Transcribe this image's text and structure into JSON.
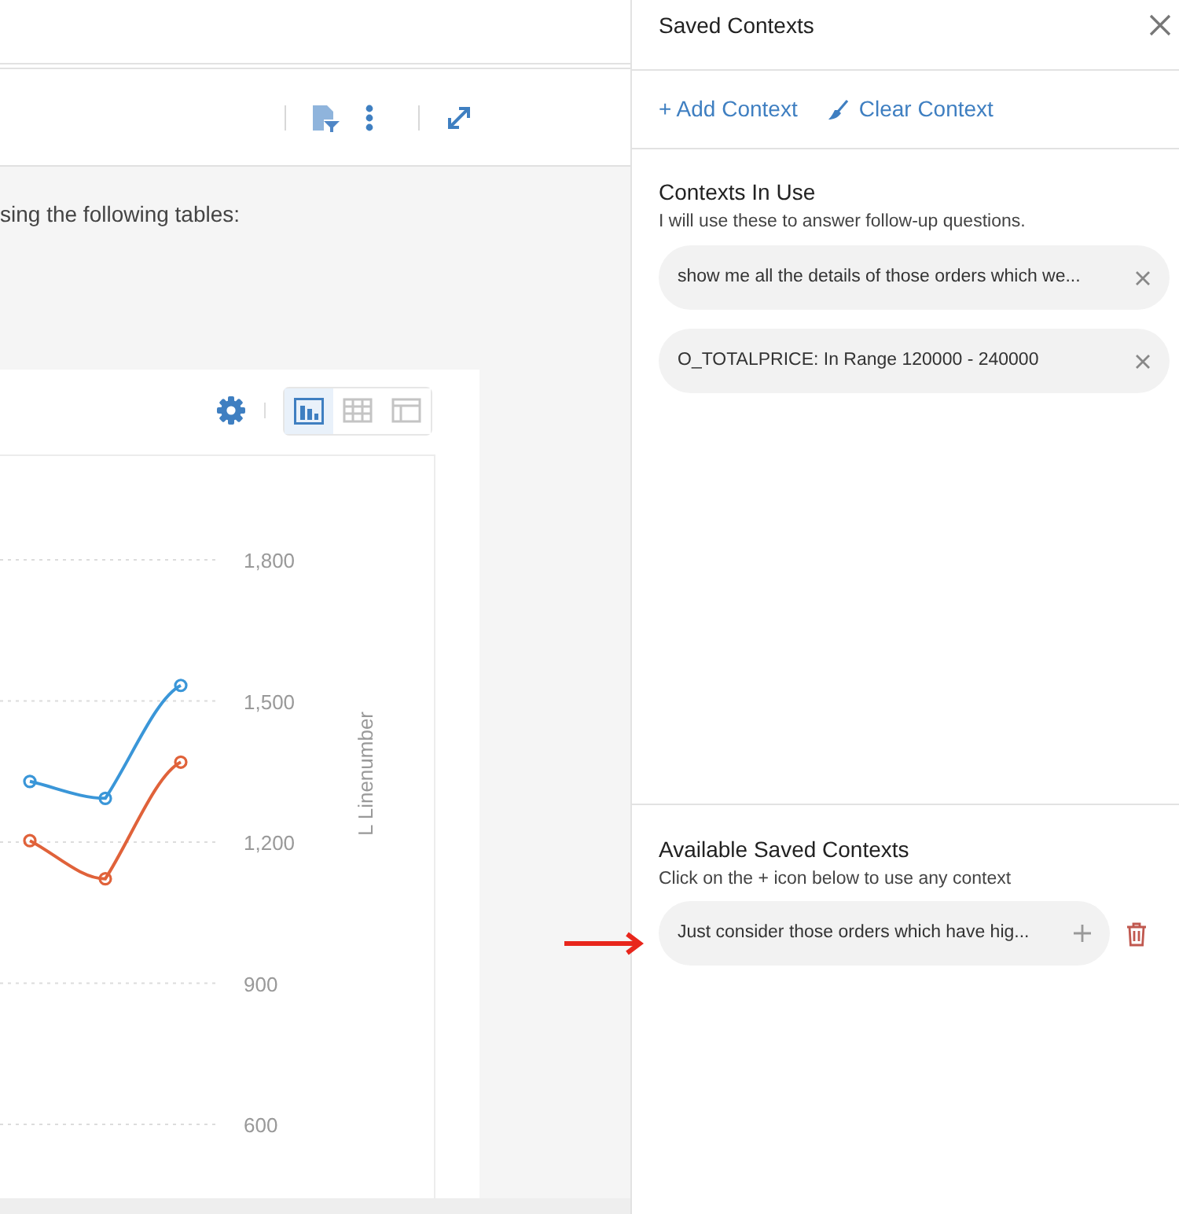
{
  "message": {
    "text": "sing the following tables:"
  },
  "chart_toolbar": {
    "views": [
      {
        "kind": "chart",
        "selected": true
      },
      {
        "kind": "grid",
        "selected": false
      },
      {
        "kind": "table",
        "selected": false
      }
    ]
  },
  "chart": {
    "chart_data": {
      "type": "line",
      "ylabel": "L Linenumber",
      "grid": true,
      "ylim": [
        600,
        1800
      ],
      "yticks": [
        {
          "value": 600,
          "label": "600"
        },
        {
          "value": 900,
          "label": "900"
        },
        {
          "value": 1200,
          "label": "1,200"
        },
        {
          "value": 1500,
          "label": "1,500"
        },
        {
          "value": 1800,
          "label": "1,800"
        }
      ],
      "series": [
        {
          "color": "#3a96d8",
          "marker": "o",
          "values": [
            1329,
            1293,
            1533
          ]
        },
        {
          "color": "#e0623a",
          "marker": "o",
          "values": [
            1203,
            1122,
            1370
          ]
        }
      ]
    }
  },
  "panel": {
    "title": "Saved Contexts",
    "actions": [
      {
        "kind": "add",
        "label": "+ Add Context"
      },
      {
        "kind": "clear",
        "label": "Clear Context"
      }
    ],
    "in_use": {
      "title": "Contexts In Use",
      "subtitle": "I will use these to answer follow-up questions.",
      "items": [
        {
          "text": "show me all the details of those orders which we..."
        },
        {
          "text": "O_TOTALPRICE: In Range 120000 - 240000"
        }
      ]
    },
    "available": {
      "title": "Available Saved Contexts",
      "subtitle": "Click on the + icon below to use any context",
      "items": [
        {
          "text": "Just consider those orders which have hig..."
        }
      ]
    }
  }
}
